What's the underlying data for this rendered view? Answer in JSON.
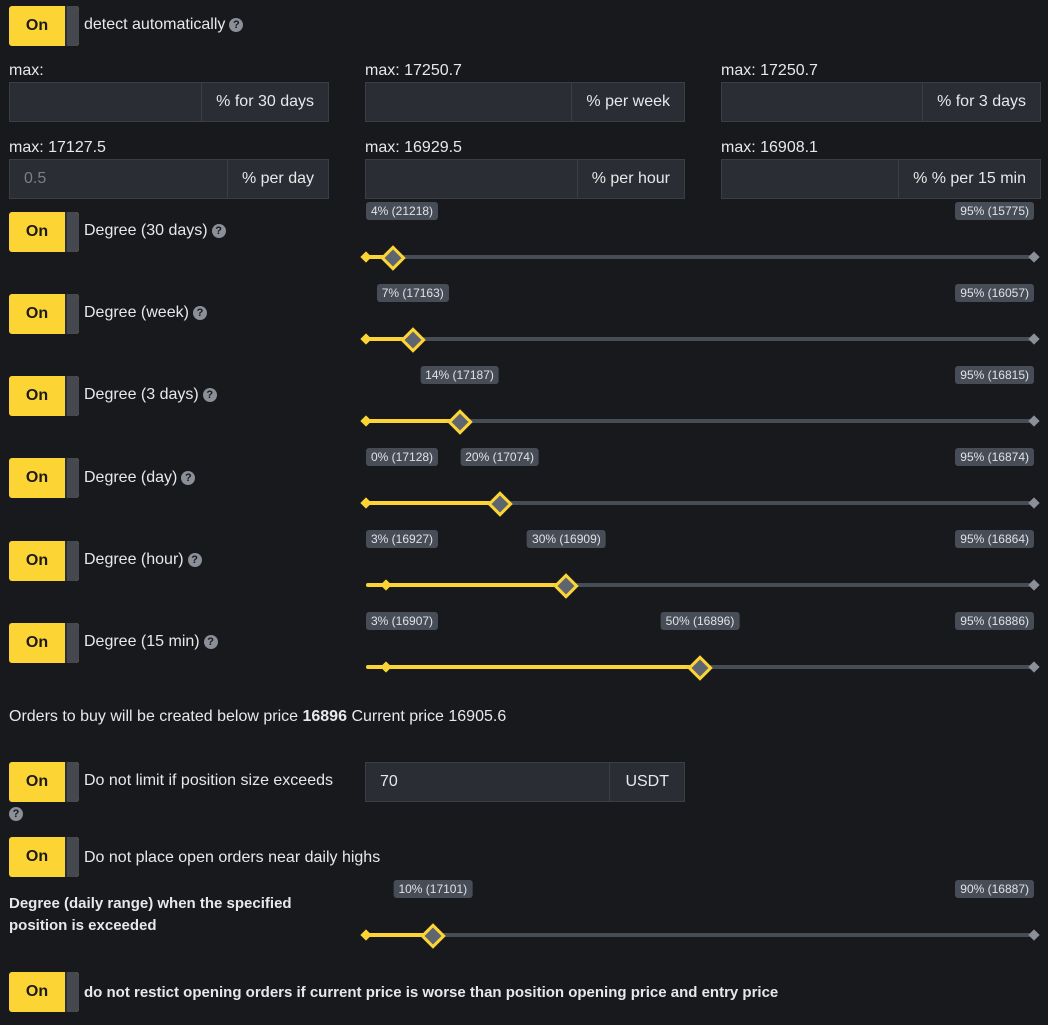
{
  "toggle_label": "On",
  "help_glyph": "?",
  "auto_detect": {
    "label": "detect automatically"
  },
  "inputs": [
    {
      "max": "max:",
      "value": "",
      "placeholder": "",
      "suffix": "% for 30 days"
    },
    {
      "max": "max: 17250.7",
      "value": "",
      "placeholder": "",
      "suffix": "% per week"
    },
    {
      "max": "max: 17250.7",
      "value": "",
      "placeholder": "",
      "suffix": "% for 3 days"
    },
    {
      "max": "max: 17127.5",
      "value": "",
      "placeholder": "0.5",
      "suffix": "% per day"
    },
    {
      "max": "max: 16929.5",
      "value": "",
      "placeholder": "",
      "suffix": "% per hour"
    },
    {
      "max": "max: 16908.1",
      "value": "",
      "placeholder": "",
      "suffix": "% % per 15 min"
    }
  ],
  "degrees": [
    {
      "label": "Degree (30 days)",
      "low": 0,
      "value": 0.04,
      "value_label": "4% (21218)",
      "max_label": "95% (15775)"
    },
    {
      "label": "Degree (week)",
      "low": 0,
      "value": 0.07,
      "value_label": "7% (17163)",
      "max_label": "95% (16057)"
    },
    {
      "label": "Degree (3 days)",
      "low": 0,
      "value": 0.14,
      "value_label": "14% (17187)",
      "max_label": "95% (16815)"
    },
    {
      "label": "Degree (day)",
      "low": 0,
      "low_label": "0% (17128)",
      "value": 0.2,
      "value_label": "20% (17074)",
      "max_label": "95% (16874)"
    },
    {
      "label": "Degree (hour)",
      "low": 0.03,
      "low_label": "3% (16927)",
      "value": 0.3,
      "value_label": "30% (16909)",
      "max_label": "95% (16864)"
    },
    {
      "label": "Degree (15 min)",
      "low": 0.03,
      "low_label": "3% (16907)",
      "value": 0.5,
      "value_label": "50% (16896)",
      "max_label": "95% (16886)"
    }
  ],
  "orders_info": {
    "prefix": "Orders to buy will be created below price",
    "price": "16896",
    "current_label": "Current price",
    "current_price": "16905.6"
  },
  "position_limit": {
    "label": "Do not limit if position size exceeds",
    "value": "70",
    "suffix": "USDT"
  },
  "daily_highs": {
    "label": "Do not place open orders near daily highs"
  },
  "daily_range": {
    "label_line1": "Degree (daily range) when the specified",
    "label_line2": "position is exceeded",
    "low": 0,
    "value": 0.1,
    "value_label": "10% (17101)",
    "max_label": "90% (16887)"
  },
  "restrict": {
    "label": "do not restict opening orders if current price is worse than position opening price and entry price"
  },
  "colors": {
    "accent": "#fcd535",
    "background": "#17191d",
    "input_bg": "#2a2d33",
    "track": "#474d57"
  }
}
